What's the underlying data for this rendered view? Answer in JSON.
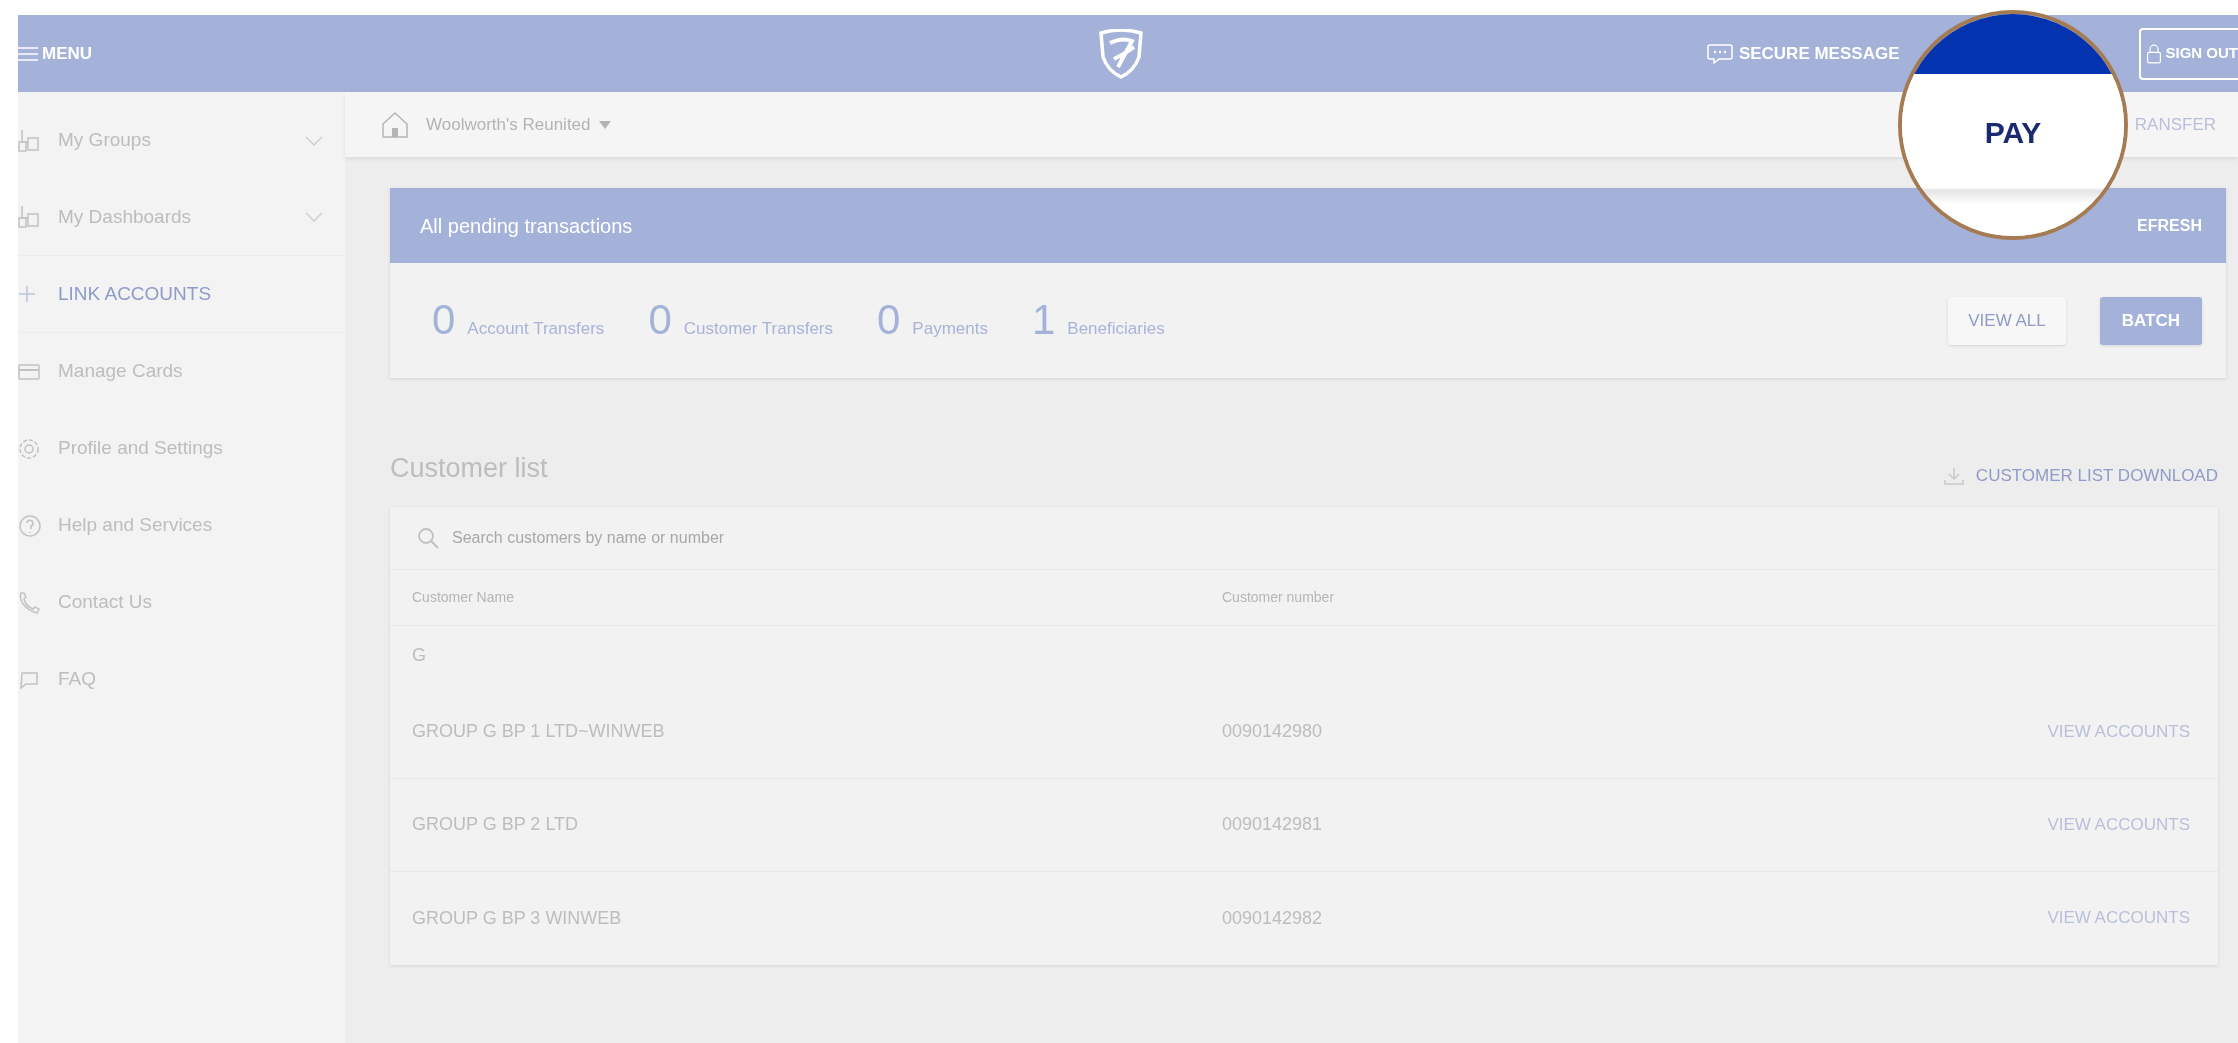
{
  "header": {
    "menu_label": "MENU",
    "secure_message": "SECURE MESSAGE",
    "sign_out": "SIGN OUT"
  },
  "sidebar": {
    "items": [
      {
        "kind": "dropdown",
        "label": "My Groups"
      },
      {
        "kind": "dropdown",
        "label": "My Dashboards"
      },
      {
        "kind": "action",
        "label": "LINK ACCOUNTS"
      },
      {
        "kind": "link",
        "label": "Manage Cards"
      },
      {
        "kind": "link",
        "label": "Profile and Settings"
      },
      {
        "kind": "link",
        "label": "Help and Services"
      },
      {
        "kind": "link",
        "label": "Contact Us"
      },
      {
        "kind": "link",
        "label": "FAQ"
      }
    ]
  },
  "subheader": {
    "breadcrumb": "Woolworth's Reunited",
    "action": "RANSFER"
  },
  "magnifier": {
    "label": "PAY"
  },
  "pending": {
    "title": "All pending transactions",
    "refresh": "EFRESH",
    "counts": [
      {
        "value": "0",
        "label": "Account Transfers"
      },
      {
        "value": "0",
        "label": "Customer Transfers"
      },
      {
        "value": "0",
        "label": "Payments"
      },
      {
        "value": "1",
        "label": "Beneficiaries"
      }
    ],
    "buttons": [
      {
        "kind": "secondary",
        "label": "VIEW ALL"
      },
      {
        "kind": "primary",
        "label": "BATCH"
      }
    ]
  },
  "customer_list": {
    "title": "Customer list",
    "download": "CUSTOMER LIST DOWNLOAD",
    "search": {
      "placeholder": "Search customers by name or number"
    },
    "columns": [
      "Customer Name",
      "Customer number"
    ],
    "rows": [
      {
        "kind": "group",
        "name": "G"
      },
      {
        "kind": "customer",
        "name": "GROUP G BP 1 LTD~WINWEB",
        "number": "0090142980",
        "action": "VIEW ACCOUNTS"
      },
      {
        "kind": "customer",
        "name": "GROUP G BP 2 LTD",
        "number": "0090142981",
        "action": "VIEW ACCOUNTS"
      },
      {
        "kind": "customer",
        "name": "GROUP G BP 3 WINWEB",
        "number": "0090142982",
        "action": "VIEW ACCOUNTS"
      }
    ]
  }
}
